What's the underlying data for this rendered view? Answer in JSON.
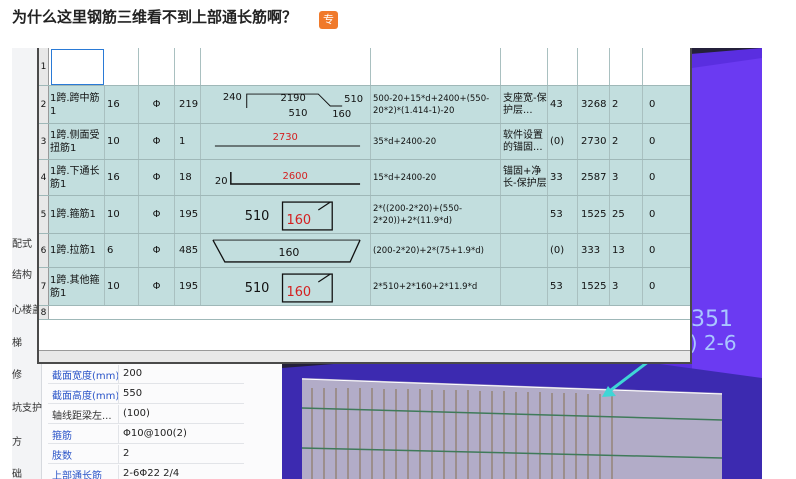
{
  "question": {
    "title": "为什么这里钢筋三维看不到上部通长筋啊？",
    "badge": "专"
  },
  "left_panel": {
    "items": [
      "配式",
      "结构",
      "心楼盖",
      "梯",
      "修",
      "坑支护",
      "方",
      "础"
    ]
  },
  "properties": [
    {
      "key": "截面宽度(mm)",
      "value": "200"
    },
    {
      "key": "截面高度(mm)",
      "value": "550"
    },
    {
      "key": "轴线距梁左...",
      "value": "(100)"
    },
    {
      "key": "箍筋",
      "value": "Φ10@100(2)"
    },
    {
      "key": "肢数",
      "value": "2"
    },
    {
      "key": "上部通长筋",
      "value": "2-6Φ22 2/4"
    }
  ],
  "scene_labels": {
    "label_a": "1351",
    "label_b": "2) 2-6"
  },
  "table": {
    "rows": [
      {
        "num": "2",
        "name": "1跨.跨中筋1",
        "dia": "16",
        "grade": "Φ",
        "code": "219",
        "shape": {
          "left": "240",
          "mid": "2190",
          "right": "510",
          "bottom": "510",
          "bottom2": "160"
        },
        "formula": "500-20+15*d+2400+(550-20*2)*(1.414-1)-20",
        "note": "支座宽-保护层...",
        "len": "43",
        "count": "3268",
        "total": "2",
        "weight": "0"
      },
      {
        "num": "3",
        "name": "1跨.侧面受扭筋1",
        "dia": "10",
        "grade": "Φ",
        "code": "1",
        "shape": {
          "mid": "2730"
        },
        "formula": "35*d+2400-20",
        "note": "软件设置的锚固...",
        "len": "(0)",
        "count": "2730",
        "total": "2",
        "weight": "0"
      },
      {
        "num": "4",
        "name": "1跨.下通长筋1",
        "dia": "16",
        "grade": "Φ",
        "code": "18",
        "shape": {
          "left": "20",
          "mid": "2600"
        },
        "formula": "15*d+2400-20",
        "note": "锚固+净长-保护层",
        "len": "33",
        "count": "2587",
        "total": "3",
        "weight": "0"
      },
      {
        "num": "5",
        "name": "1跨.箍筋1",
        "dia": "10",
        "grade": "Φ",
        "code": "195",
        "shape": {
          "left": "510",
          "mid": "160"
        },
        "formula": "2*((200-2*20)+(550-2*20))+2*(11.9*d)",
        "note": "",
        "len": "53",
        "count": "1525",
        "total": "25",
        "weight": "0"
      },
      {
        "num": "6",
        "name": "1跨.拉筋1",
        "dia": "6",
        "grade": "Φ",
        "code": "485",
        "shape": {
          "mid": "160"
        },
        "formula": "(200-2*20)+2*(75+1.9*d)",
        "note": "",
        "len": "(0)",
        "count": "333",
        "total": "13",
        "weight": "0"
      },
      {
        "num": "7",
        "name": "1跨.其他箍筋1",
        "dia": "10",
        "grade": "Φ",
        "code": "195",
        "shape": {
          "left": "510",
          "mid": "160"
        },
        "formula": "2*510+2*160+2*11.9*d",
        "note": "",
        "len": "53",
        "count": "1525",
        "total": "3",
        "weight": "0"
      }
    ],
    "last_row_num": "8",
    "first_row_num": "1"
  }
}
